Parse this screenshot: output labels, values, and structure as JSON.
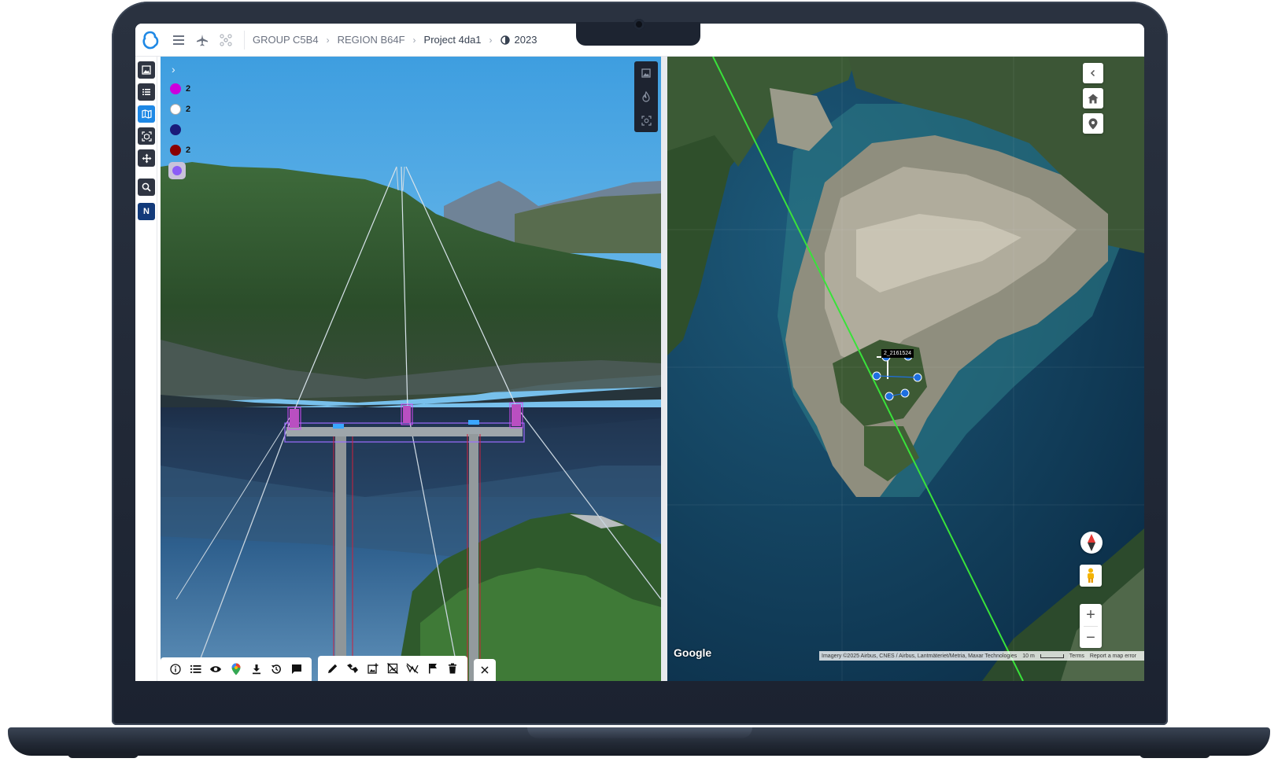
{
  "header": {
    "breadcrumbs": [
      "GROUP C5B4",
      "REGION B64F",
      "Project 4da1",
      "2023"
    ]
  },
  "rail": {
    "n_label": "N"
  },
  "legend": {
    "items": [
      {
        "color": "#cc00dd",
        "count": "2"
      },
      {
        "color": "#ffffff",
        "count": "2"
      },
      {
        "color": "#1a1a7a",
        "count": ""
      },
      {
        "color": "#8b0000",
        "count": "2"
      }
    ],
    "last_color": "#8b5cf6"
  },
  "map": {
    "asset_label": "2_2161524",
    "google_label": "Google",
    "attribution": "Imagery ©2025 Airbus, CNES / Airbus, Lantmäteriet/Metria, Maxar Technologies",
    "scale": "10 m",
    "terms": "Terms",
    "report": "Report a map error",
    "line_color": "#39e23a"
  },
  "colors": {
    "accent": "#1e88e5",
    "dark_button": "#2f3542",
    "n_button": "#123a7a"
  }
}
